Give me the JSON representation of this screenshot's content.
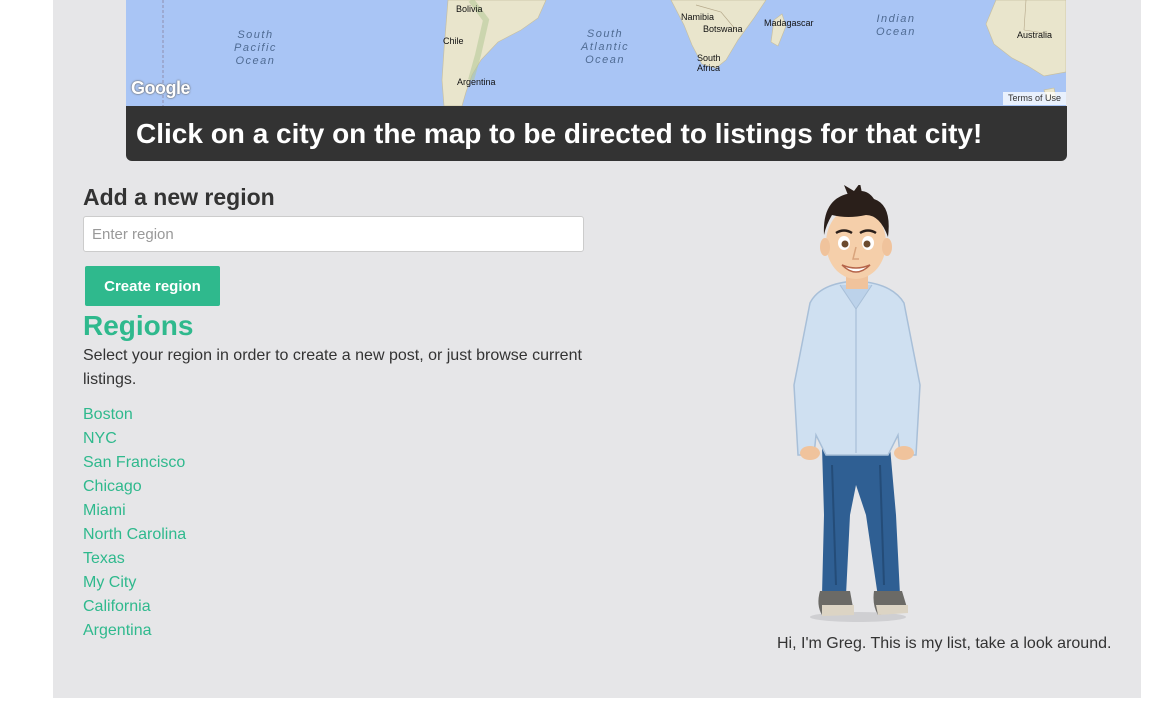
{
  "map": {
    "labels": {
      "bolivia": "Bolivia",
      "chile": "Chile",
      "argentina": "Argentina",
      "namibia": "Namibia",
      "botswana": "Botswana",
      "madagascar": "Madagascar",
      "south_africa": "South\nAfrica",
      "australia": "Australia"
    },
    "oceans": {
      "south_pacific": "South\nPacific\nOcean",
      "south_atlantic": "South\nAtlantic\nOcean",
      "indian": "Indian\nOcean"
    },
    "google_logo": "Google",
    "terms": "Terms of Use"
  },
  "banner": {
    "text": "Click on a city on the map to be directed to listings for that city!"
  },
  "add_region": {
    "title": "Add a new region",
    "placeholder": "Enter region",
    "button": "Create region"
  },
  "regions": {
    "title": "Regions",
    "description": "Select your region in order to create a new post, or just browse current listings.",
    "items": [
      "Boston",
      "NYC",
      "San Francisco",
      "Chicago",
      "Miami",
      "North Carolina",
      "Texas",
      "My City",
      "California",
      "Argentina"
    ]
  },
  "greg": {
    "caption": "Hi, I'm Greg. This is my list, take a look around."
  },
  "colors": {
    "accent": "#2fb98d",
    "banner_bg": "#333333",
    "panel_bg": "#e6e6e8",
    "water": "#a9c5f5",
    "land": "#eae6cf"
  }
}
